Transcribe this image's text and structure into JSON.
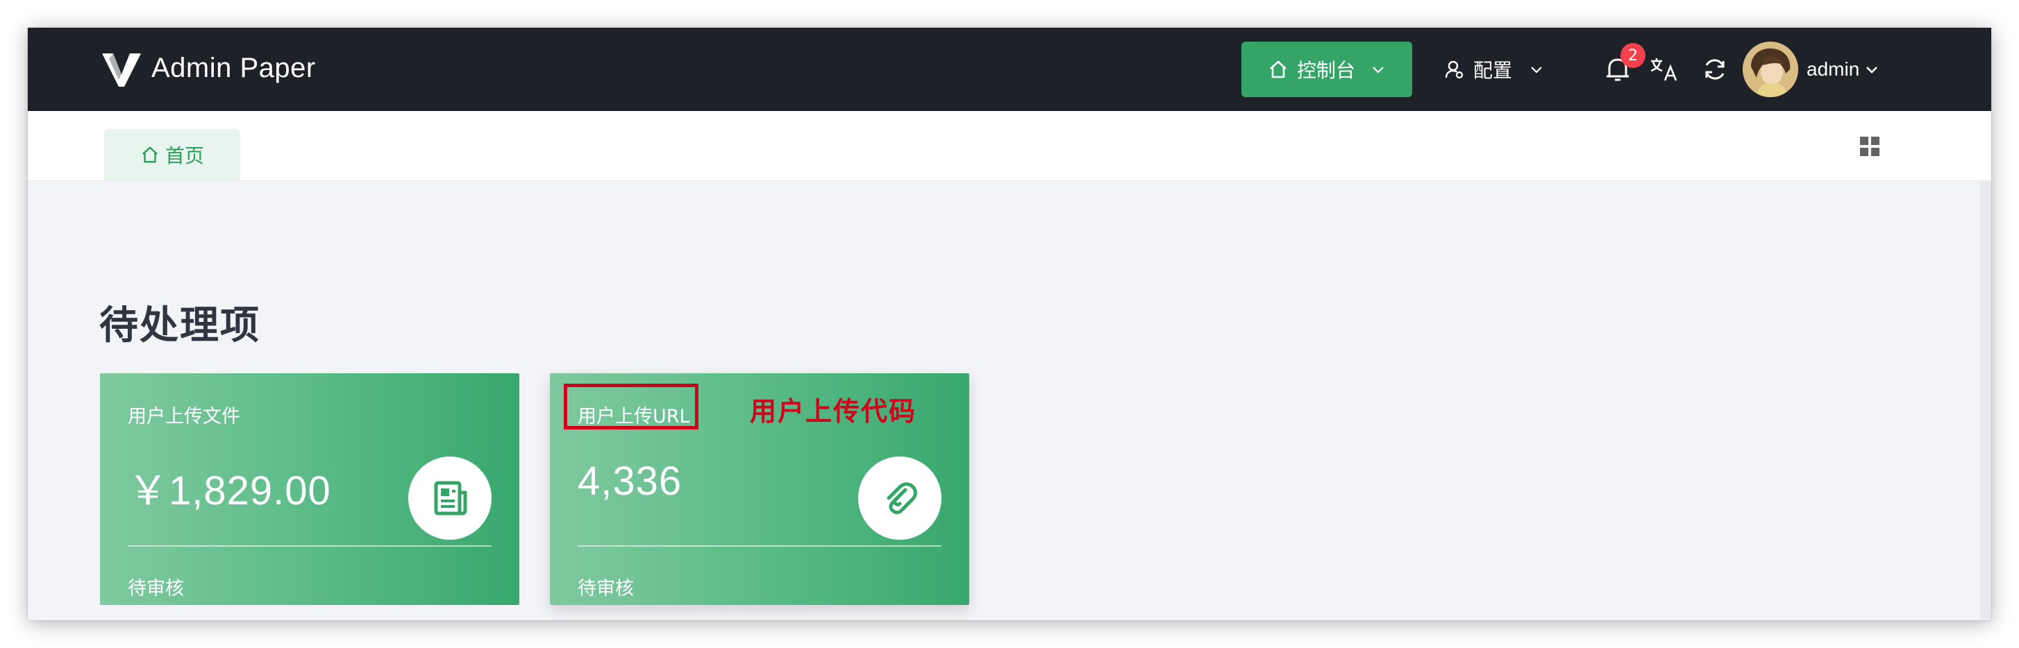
{
  "header": {
    "app_title": "Admin Paper",
    "console_label": "控制台",
    "config_label": "配置",
    "notification_count": "2",
    "username": "admin"
  },
  "tabs": [
    {
      "label": "首页",
      "active": true
    }
  ],
  "main": {
    "section_title": "待处理项",
    "cards": [
      {
        "label": "用户上传文件",
        "value": "￥1,829.00",
        "footer": "待审核",
        "icon": "newspaper-icon"
      },
      {
        "label": "用户上传URL",
        "value": "4,336",
        "footer": "待审核",
        "icon": "paperclip-icon"
      }
    ],
    "annotation": "用户上传代码"
  },
  "colors": {
    "topbar": "#1f2128",
    "accent": "#34a566",
    "badge": "#f5414b",
    "annotation": "#d0021b"
  }
}
